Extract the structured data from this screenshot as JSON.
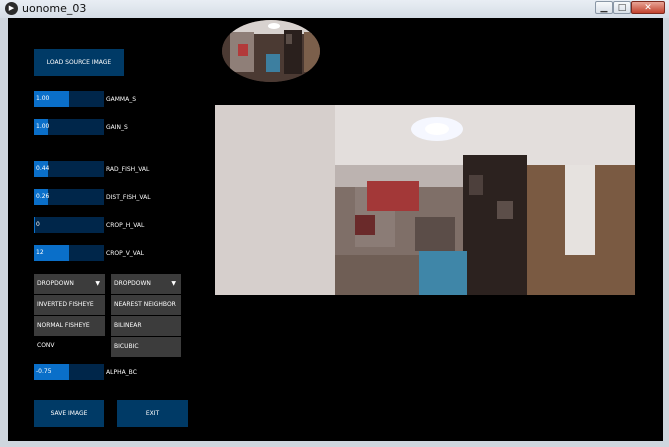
{
  "window": {
    "title": "uonome_03",
    "minimize": "▁",
    "maximize": "□",
    "close": "✕",
    "icon": "app-play-icon"
  },
  "buttons": {
    "load": "LOAD SOURCE IMAGE",
    "save": "SAVE IMAGE",
    "exit": "EXIT"
  },
  "sliders": [
    {
      "id": "gamma",
      "value": "1.00",
      "label": "GAMMA_S",
      "fill_fraction": 0.5
    },
    {
      "id": "gain",
      "value": "1.00",
      "label": "GAIN_S",
      "fill_fraction": 0.2
    },
    {
      "id": "rad-fish",
      "value": "0.44",
      "label": "RAD_FISH_VAL",
      "fill_fraction": 0.2
    },
    {
      "id": "dist-fish",
      "value": "0.26",
      "label": "DIST_FISH_VAL",
      "fill_fraction": 0.2
    },
    {
      "id": "crop-h",
      "value": "0",
      "label": "CROP_H_VAL",
      "fill_fraction": 0.02
    },
    {
      "id": "crop-v",
      "value": "12",
      "label": "CROP_V_VAL",
      "fill_fraction": 0.5
    },
    {
      "id": "alpha-bc",
      "value": "-0.75",
      "label": "ALPHA_BC",
      "fill_fraction": 0.5
    }
  ],
  "dropdown_conv": {
    "label": "DROPDOWN",
    "items": [
      "INVERTED FISHEYE CONV",
      "NORMAL FISHEYE CONV"
    ]
  },
  "dropdown_interp": {
    "label": "DROPDOWN",
    "items": [
      "NEAREST NEIGHBOR",
      "BILINEAR",
      "BICUBIC"
    ]
  },
  "colors": {
    "button": "#003a66",
    "slider_track": "#00264a",
    "slider_fill": "#0a6fc9",
    "dropdown": "#3c3c3c",
    "canvas": "#000000"
  }
}
